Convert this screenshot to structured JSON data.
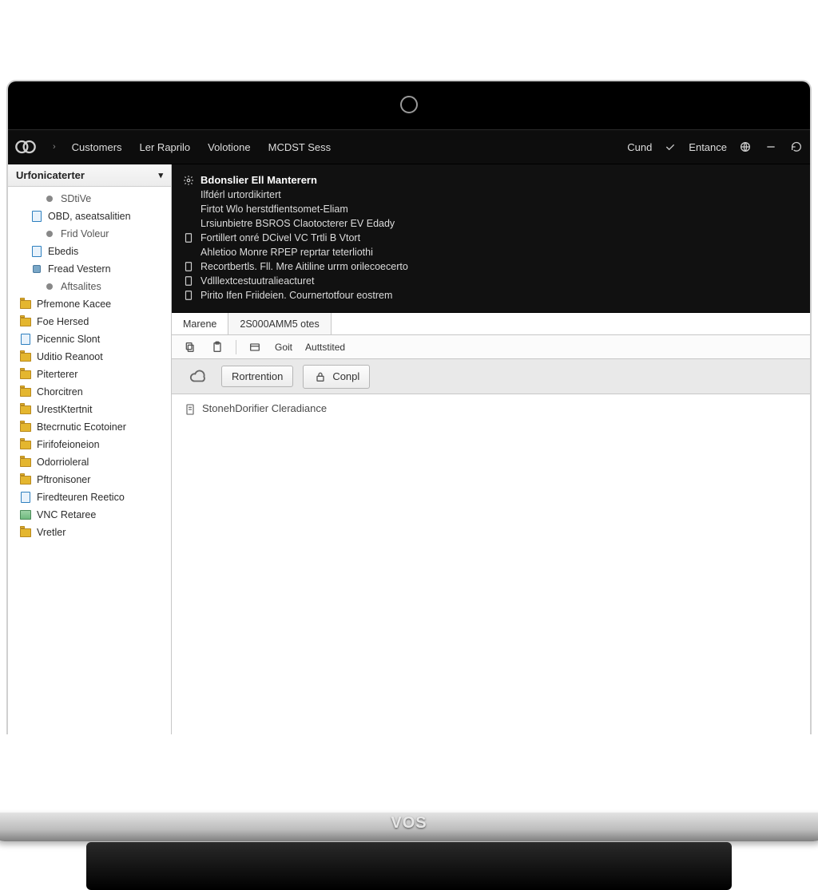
{
  "brand": "VOS",
  "topnav": {
    "items": [
      "Customers",
      "Ler Raprilo",
      "Volotione",
      "MCDST Sess"
    ],
    "right": {
      "cund": "Cund",
      "entance": "Entance"
    }
  },
  "sidebar": {
    "header": "Urfonicaterter",
    "items": [
      {
        "label": "SDtiVe",
        "icon": "dot",
        "level": 2
      },
      {
        "label": "OBD, aseatsalitien",
        "icon": "doc",
        "level": 1
      },
      {
        "label": "Frid Voleur",
        "icon": "dot",
        "level": 2
      },
      {
        "label": "Ebedis",
        "icon": "doc",
        "level": 1
      },
      {
        "label": "Fread Vestern",
        "icon": "node",
        "level": 1
      },
      {
        "label": "Aftsalites",
        "icon": "dot",
        "level": 2
      },
      {
        "label": "Pfremone Kacee",
        "icon": "folder",
        "level": 0
      },
      {
        "label": "Foe Hersed",
        "icon": "folder",
        "level": 0
      },
      {
        "label": "Picennic Slont",
        "icon": "doc",
        "level": 0
      },
      {
        "label": "Uditio Reanoot",
        "icon": "folder",
        "level": 0
      },
      {
        "label": "Piterterer",
        "icon": "folder",
        "level": 0
      },
      {
        "label": "Chorcitren",
        "icon": "folder",
        "level": 0
      },
      {
        "label": "UrestKtertnit",
        "icon": "folder",
        "level": 0
      },
      {
        "label": "Btecrnutic Ecotoiner",
        "icon": "folder",
        "level": 0
      },
      {
        "label": "Firifofeioneion",
        "icon": "folder",
        "level": 0
      },
      {
        "label": "Odorrioleral",
        "icon": "folder",
        "level": 0
      },
      {
        "label": "Pftronisoner",
        "icon": "folder",
        "level": 0
      },
      {
        "label": "Firedteuren Reetico",
        "icon": "doc",
        "level": 0
      },
      {
        "label": "VNC Retaree",
        "icon": "app",
        "level": 0
      },
      {
        "label": "Vretler",
        "icon": "folder",
        "level": 0
      }
    ]
  },
  "dark_panel": {
    "title": "Bdonslier Ell Manterern",
    "lines": [
      "Ilfdérl urtordikirtert",
      "Firtot Wlo herstdfientsomet-Eliam",
      "Lrsiunbietre BSROS Claotocterer EV Edady",
      "Fortillert onré DCivel VC Trtli B Vtort",
      "Ahletioo Monre RPEP reprtar teterliothi",
      "Recortbertls. Fll. Mre Aitiline urrm orilecoecerto",
      "Vdlllextcestuutralieacturet",
      "Pirito Ifen Friideien. Cournertotfour eostrem"
    ],
    "line_icons": [
      "gear",
      "",
      "",
      "",
      "doc",
      "",
      "doc",
      "doc",
      "doc"
    ]
  },
  "tabs": {
    "left": "Marene",
    "right": "2S000AMM5 otes"
  },
  "toolbar": {
    "goit": "Goit",
    "added": "Auttstited"
  },
  "actionbar": {
    "primary": "Rortrention",
    "secondary": "Conpl"
  },
  "content": {
    "line": "StonehDorifier Cleradiance"
  }
}
